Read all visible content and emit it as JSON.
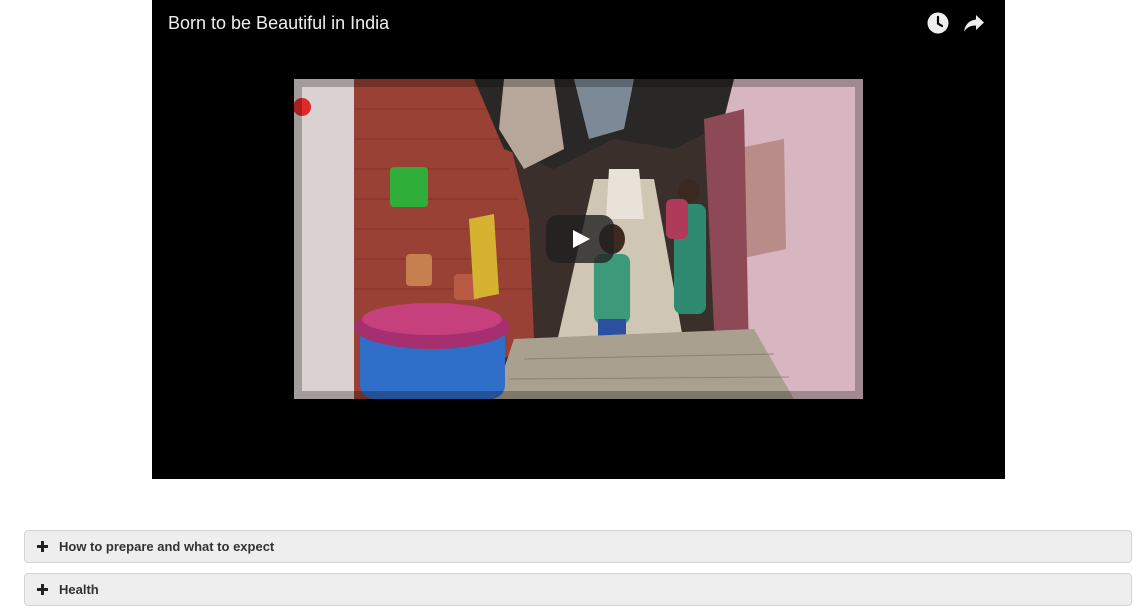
{
  "video": {
    "title": "Born to be Beautiful in India",
    "icons": {
      "watch_later": "clock-icon",
      "share": "share-arrow-icon",
      "play": "play-icon"
    }
  },
  "accordion": {
    "items": [
      {
        "label": "How to prepare and what to expect",
        "icon": "plus-icon"
      },
      {
        "label": "Health",
        "icon": "plus-icon"
      }
    ]
  },
  "colors": {
    "player_background": "#000000",
    "accordion_background": "#eeeeee",
    "accordion_border": "#d4d4d4",
    "text": "#333333"
  }
}
